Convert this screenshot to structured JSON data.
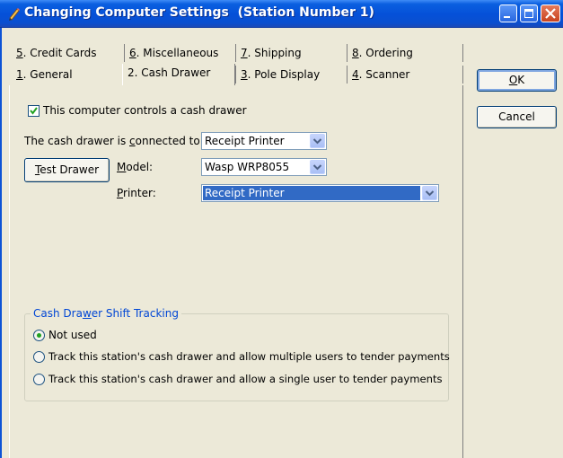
{
  "window": {
    "title": "Changing Computer Settings  (Station Number 1)",
    "icon": "pencil-icon"
  },
  "tabs_back_row": [
    {
      "key": "5",
      "label": ". Credit Cards"
    },
    {
      "key": "6",
      "label": ". Miscellaneous"
    },
    {
      "key": "7",
      "label": ". Shipping"
    },
    {
      "key": "8",
      "label": ". Ordering"
    }
  ],
  "tabs_front_row": [
    {
      "key": "1",
      "label": ". General"
    },
    {
      "key": "2",
      "label": ". Cash Drawer",
      "active": true
    },
    {
      "key": "3",
      "label": ". Pole Display"
    },
    {
      "key": "4",
      "label": ". Scanner"
    }
  ],
  "buttons": {
    "ok": {
      "mn": "O",
      "rest": "K"
    },
    "cancel": "Cancel",
    "test_drawer": {
      "mn": "T",
      "rest": "est Drawer"
    }
  },
  "cash_drawer": {
    "controls_checkbox": {
      "checked": true,
      "label": "This computer controls a cash drawer"
    },
    "connected_label": {
      "pre": "The cash drawer is ",
      "mn": "c",
      "post": "onnected to:"
    },
    "connected_value": "Receipt Printer",
    "model_label": {
      "mn": "M",
      "post": "odel:"
    },
    "model_value": "Wasp WRP8055",
    "printer_label": {
      "mn": "P",
      "post": "rinter:"
    },
    "printer_value": "Receipt Printer"
  },
  "shift_tracking": {
    "title": {
      "pre": "Cash Dra",
      "mn": "w",
      "post": "er Shift Tracking"
    },
    "options": [
      {
        "label": "Not used",
        "selected": true
      },
      {
        "label": "Track this station's cash drawer and allow multiple users to tender payments",
        "selected": false
      },
      {
        "label": "Track this station's cash drawer and allow a single user to tender payments",
        "selected": false
      }
    ]
  },
  "colors": {
    "titlebar": "#0550d8",
    "dialog_bg": "#ece9d8",
    "group_title": "#0046d5",
    "selection": "#316ac5"
  }
}
